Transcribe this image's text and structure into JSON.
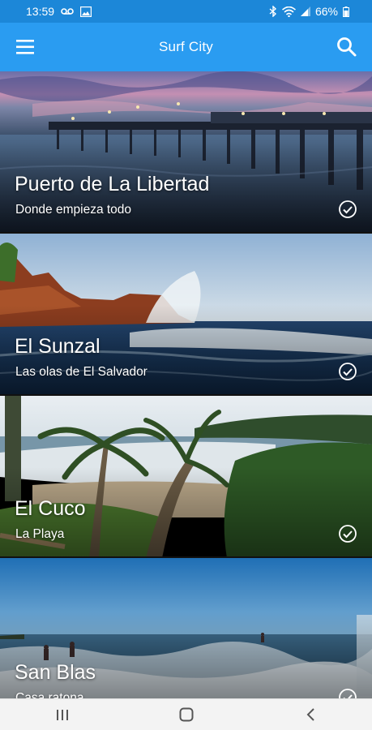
{
  "status_bar": {
    "time": "13:59",
    "battery": "66%",
    "icons": [
      "voicemail-icon",
      "image-icon",
      "bluetooth-icon",
      "wifi-icon",
      "signal-icon",
      "battery-icon"
    ]
  },
  "app_bar": {
    "title": "Surf City",
    "menu_icon": "hamburger-menu-icon",
    "search_icon": "search-icon",
    "color": "#2a9cf1"
  },
  "locations": [
    {
      "title": "Puerto de La Libertad",
      "subtitle": "Donde empieza todo",
      "checked": true
    },
    {
      "title": "El Sunzal",
      "subtitle": "Las olas de El Salvador",
      "checked": true
    },
    {
      "title": "El Cuco",
      "subtitle": "La Playa",
      "checked": true
    },
    {
      "title": "San Blas",
      "subtitle": "Casa ratona",
      "checked": true
    }
  ],
  "nav_bar": {
    "icons": [
      "recent-apps-icon",
      "home-icon",
      "back-icon"
    ]
  }
}
